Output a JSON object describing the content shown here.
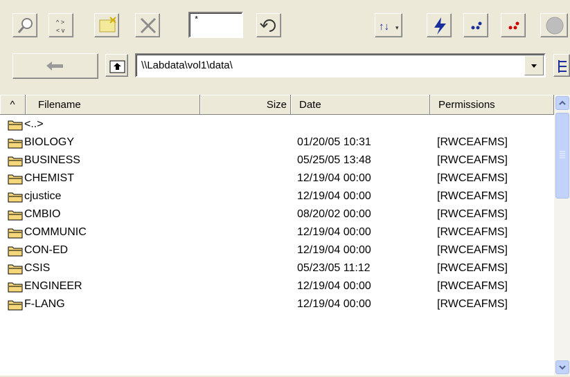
{
  "toolbar": {
    "filter_value": "*",
    "buttons": [
      {
        "name": "find-icon"
      },
      {
        "name": "select-all-icon"
      },
      {
        "name": "new-folder-icon"
      },
      {
        "name": "delete-icon"
      },
      {
        "name": "refresh-icon"
      },
      {
        "name": "sort-icon"
      },
      {
        "name": "connect-icon"
      },
      {
        "name": "blue-dots-icon"
      },
      {
        "name": "red-dots-icon"
      },
      {
        "name": "stop-icon"
      }
    ]
  },
  "navigation": {
    "path": "\\\\Labdata\\vol1\\data\\"
  },
  "list": {
    "columns": [
      {
        "label": "^"
      },
      {
        "label": "Filename"
      },
      {
        "label": "Size"
      },
      {
        "label": "Date"
      },
      {
        "label": "Permissions"
      }
    ],
    "rows": [
      {
        "name": "<..>",
        "date": "",
        "perm": ""
      },
      {
        "name": "BIOLOGY",
        "date": "01/20/05  10:31",
        "perm": "[RWCEAFMS]"
      },
      {
        "name": "BUSINESS",
        "date": "05/25/05  13:48",
        "perm": "[RWCEAFMS]"
      },
      {
        "name": "CHEMIST",
        "date": "12/19/04  00:00",
        "perm": "[RWCEAFMS]"
      },
      {
        "name": "cjustice",
        "date": "12/19/04  00:00",
        "perm": "[RWCEAFMS]"
      },
      {
        "name": "CMBIO",
        "date": "08/20/02  00:00",
        "perm": "[RWCEAFMS]"
      },
      {
        "name": "COMMUNIC",
        "date": "12/19/04  00:00",
        "perm": "[RWCEAFMS]"
      },
      {
        "name": "CON-ED",
        "date": "12/19/04  00:00",
        "perm": "[RWCEAFMS]"
      },
      {
        "name": "CSIS",
        "date": "05/23/05  11:12",
        "perm": "[RWCEAFMS]"
      },
      {
        "name": "ENGINEER",
        "date": "12/19/04  00:00",
        "perm": "[RWCEAFMS]"
      },
      {
        "name": "F-LANG",
        "date": "12/19/04  00:00",
        "perm": "[RWCEAFMS]"
      }
    ]
  }
}
